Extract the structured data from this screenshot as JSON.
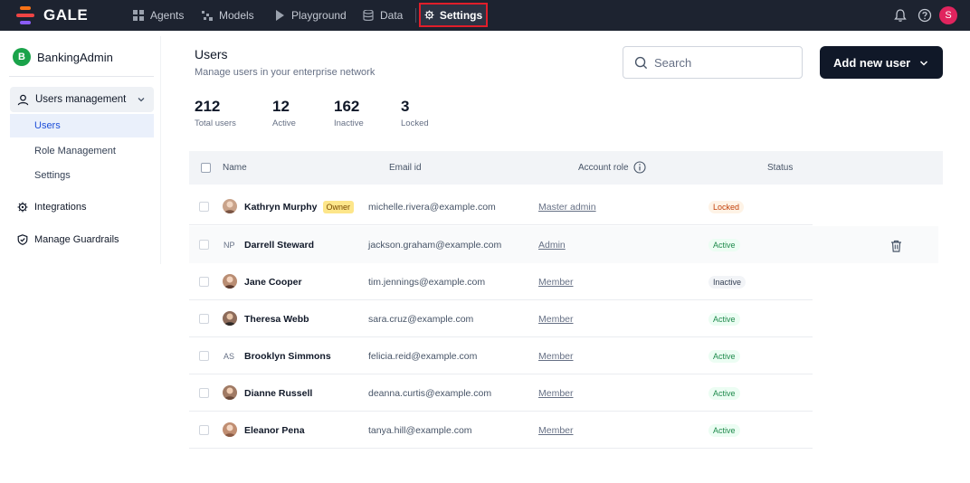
{
  "app": {
    "name": "GALE"
  },
  "nav": {
    "items": [
      {
        "label": "Agents",
        "icon": "grid-icon"
      },
      {
        "label": "Models",
        "icon": "models-icon"
      },
      {
        "label": "Playground",
        "icon": "play-icon"
      },
      {
        "label": "Data",
        "icon": "database-icon"
      },
      {
        "label": "Settings",
        "icon": "gear-icon",
        "active": true
      }
    ],
    "user_initial": "S",
    "highlight_color": "#e01e2a"
  },
  "sidebar": {
    "workspace_initial": "B",
    "workspace_name": "BankingAdmin",
    "group_label": "Users management",
    "sub_items": [
      {
        "label": "Users",
        "active": true
      },
      {
        "label": "Role Management"
      },
      {
        "label": "Settings"
      }
    ],
    "items": [
      {
        "label": "Integrations",
        "icon": "gear-icon"
      },
      {
        "label": "Manage Guardrails",
        "icon": "shield-icon"
      }
    ]
  },
  "header": {
    "title": "Users",
    "subtitle": "Manage users in your enterprise network",
    "search_placeholder": "Search",
    "add_button_label": "Add new user"
  },
  "stats": [
    {
      "value": "212",
      "label": "Total users"
    },
    {
      "value": "12",
      "label": "Active"
    },
    {
      "value": "162",
      "label": "Inactive"
    },
    {
      "value": "3",
      "label": "Locked"
    }
  ],
  "table": {
    "columns": {
      "name": "Name",
      "email": "Email id",
      "role": "Account role",
      "status": "Status"
    },
    "rows": [
      {
        "name": "Kathryn Murphy",
        "badge": "Owner",
        "email": "michelle.rivera@example.com",
        "role": "Master admin",
        "status": "Locked",
        "avatar": "photo"
      },
      {
        "name": "Darrell Steward",
        "initials": "NP",
        "email": "jackson.graham@example.com",
        "role": "Admin",
        "status": "Active",
        "avatar": "initials"
      },
      {
        "name": "Jane Cooper",
        "email": "tim.jennings@example.com",
        "role": "Member",
        "status": "Inactive",
        "avatar": "photo"
      },
      {
        "name": "Theresa Webb",
        "email": "sara.cruz@example.com",
        "role": "Member",
        "status": "Active",
        "avatar": "photo"
      },
      {
        "name": "Brooklyn Simmons",
        "initials": "AS",
        "email": "felicia.reid@example.com",
        "role": "Member",
        "status": "Active",
        "avatar": "initials"
      },
      {
        "name": "Dianne Russell",
        "email": "deanna.curtis@example.com",
        "role": "Member",
        "status": "Active",
        "avatar": "photo"
      },
      {
        "name": "Eleanor Pena",
        "email": "tanya.hill@example.com",
        "role": "Member",
        "status": "Active",
        "avatar": "photo"
      }
    ]
  },
  "colors": {
    "topbar": "#1d2330",
    "primary_button": "#101828",
    "active_status": "#1f8a4c",
    "locked_status": "#c2410c",
    "owner_badge": "#fde68a"
  }
}
